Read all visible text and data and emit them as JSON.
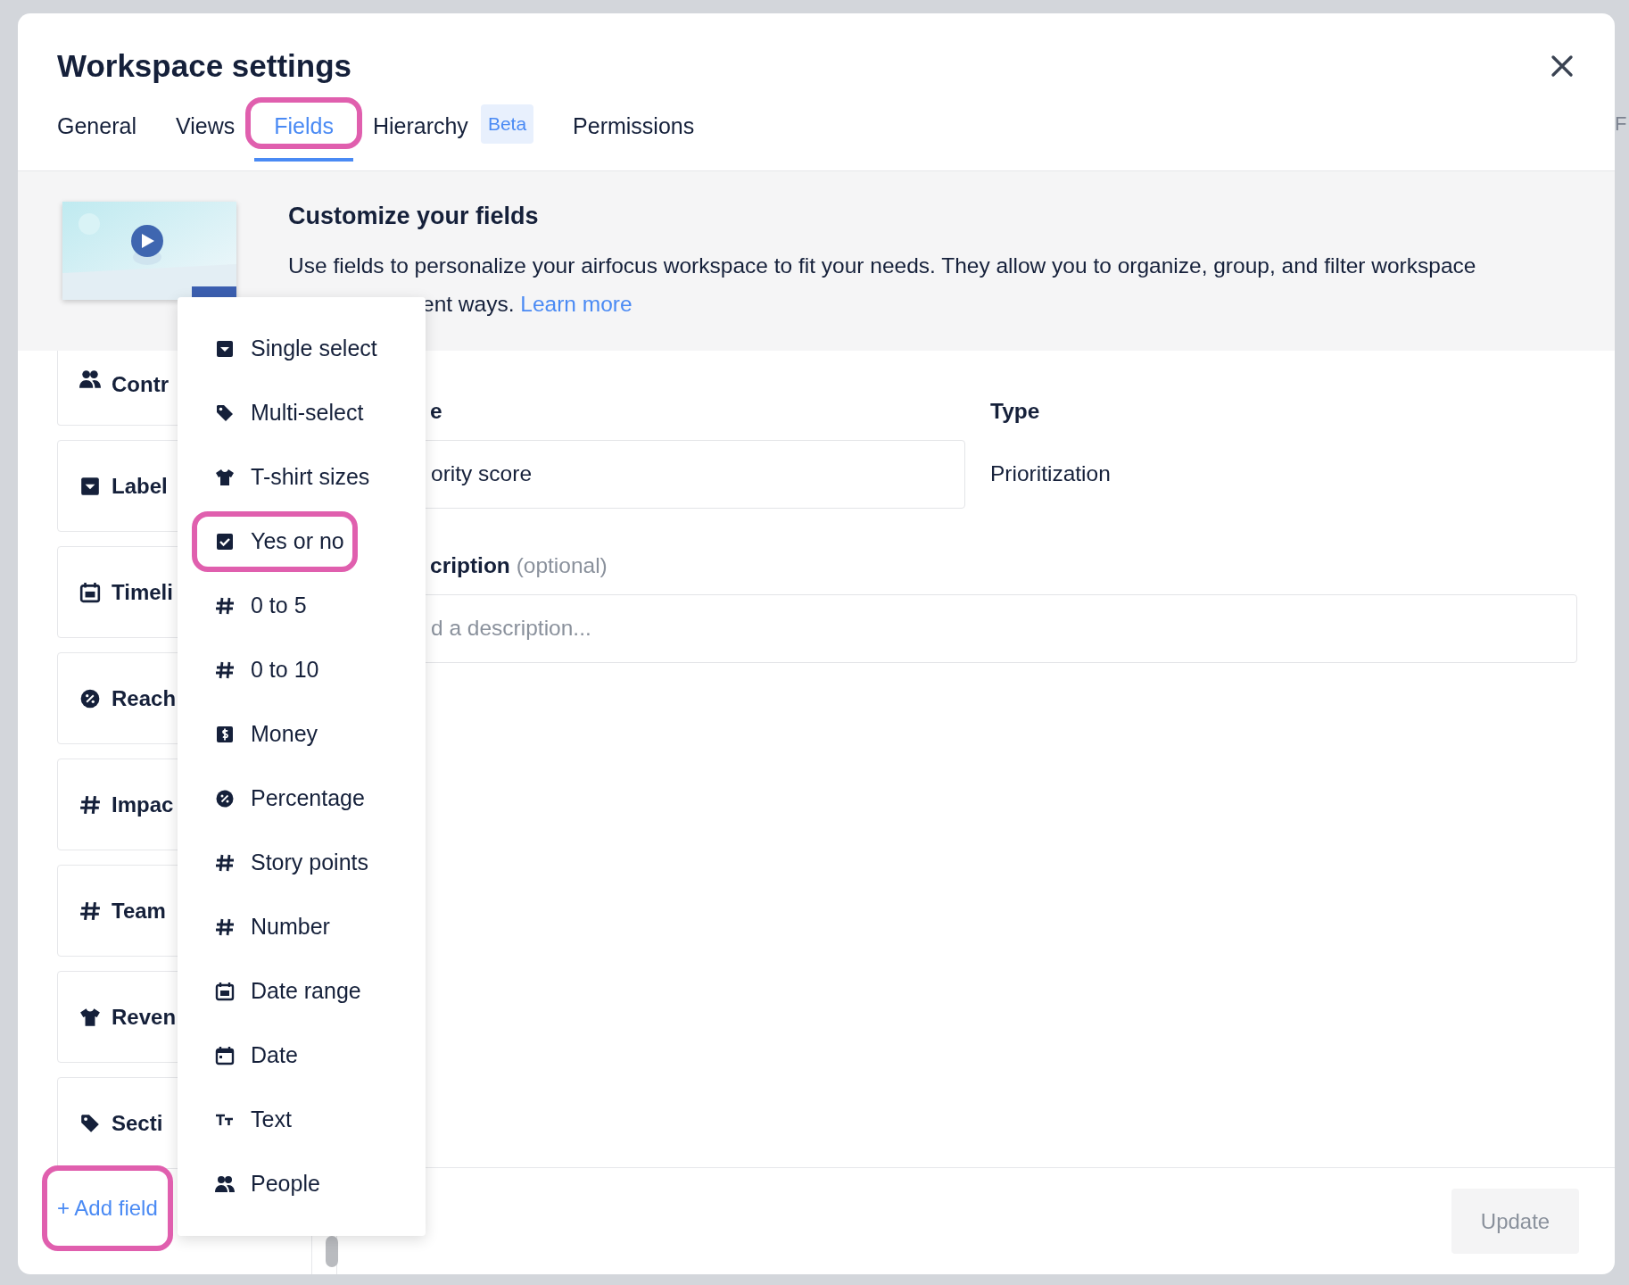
{
  "background": {
    "cut_text": "F"
  },
  "dialog": {
    "title": "Workspace settings"
  },
  "tabs": [
    {
      "label": "General",
      "selected": false,
      "highlighted": false
    },
    {
      "label": "Views",
      "selected": false,
      "highlighted": false
    },
    {
      "label": "Fields",
      "selected": true,
      "highlighted": true
    },
    {
      "label": "Hierarchy",
      "selected": false,
      "highlighted": false,
      "badge": "Beta"
    },
    {
      "label": "Permissions",
      "selected": false,
      "highlighted": false
    }
  ],
  "intro": {
    "heading": "Customize your fields",
    "line_1": "Use fields to personalize your airfocus workspace to fit your needs. They allow you to organize, group, and filter workspace",
    "line_2": "ent ways.",
    "link": "Learn more"
  },
  "fields": [
    {
      "label": "Contr",
      "kind": "people"
    },
    {
      "label": "Label",
      "kind": "select"
    },
    {
      "label": "Timeli",
      "kind": "calendar"
    },
    {
      "label": "Reach",
      "kind": "percent"
    },
    {
      "label": "Impac",
      "kind": "hash"
    },
    {
      "label": "Team",
      "kind": "hash"
    },
    {
      "label": "Reven",
      "kind": "tshirt"
    },
    {
      "label": "Secti",
      "kind": "tag"
    }
  ],
  "add_field": {
    "label": "+ Add field",
    "highlighted": true
  },
  "field_types_menu": [
    {
      "label": "Single select",
      "kind": "select",
      "highlighted": false
    },
    {
      "label": "Multi-select",
      "kind": "tag",
      "highlighted": false
    },
    {
      "label": "T-shirt sizes",
      "kind": "tshirt",
      "highlighted": false
    },
    {
      "label": "Yes or no",
      "kind": "checkbox",
      "highlighted": true
    },
    {
      "label": "0 to 5",
      "kind": "hash",
      "highlighted": false
    },
    {
      "label": "0 to 10",
      "kind": "hash",
      "highlighted": false
    },
    {
      "label": "Money",
      "kind": "money",
      "highlighted": false
    },
    {
      "label": "Percentage",
      "kind": "percent",
      "highlighted": false
    },
    {
      "label": "Story points",
      "kind": "hash",
      "highlighted": false
    },
    {
      "label": "Number",
      "kind": "hash",
      "highlighted": false
    },
    {
      "label": "Date range",
      "kind": "calendar",
      "highlighted": false
    },
    {
      "label": "Date",
      "kind": "date",
      "highlighted": false
    },
    {
      "label": "Text",
      "kind": "text",
      "highlighted": false
    },
    {
      "label": "People",
      "kind": "people",
      "highlighted": false
    }
  ],
  "form": {
    "name_label": "e",
    "name_value": "ority score",
    "type_label": "Type",
    "type_value": "Prioritization",
    "description_label": "cription",
    "description_hint": "(optional)",
    "description_placeholder": "d a description..."
  },
  "footer": {
    "button": "Update",
    "disabled": true
  }
}
